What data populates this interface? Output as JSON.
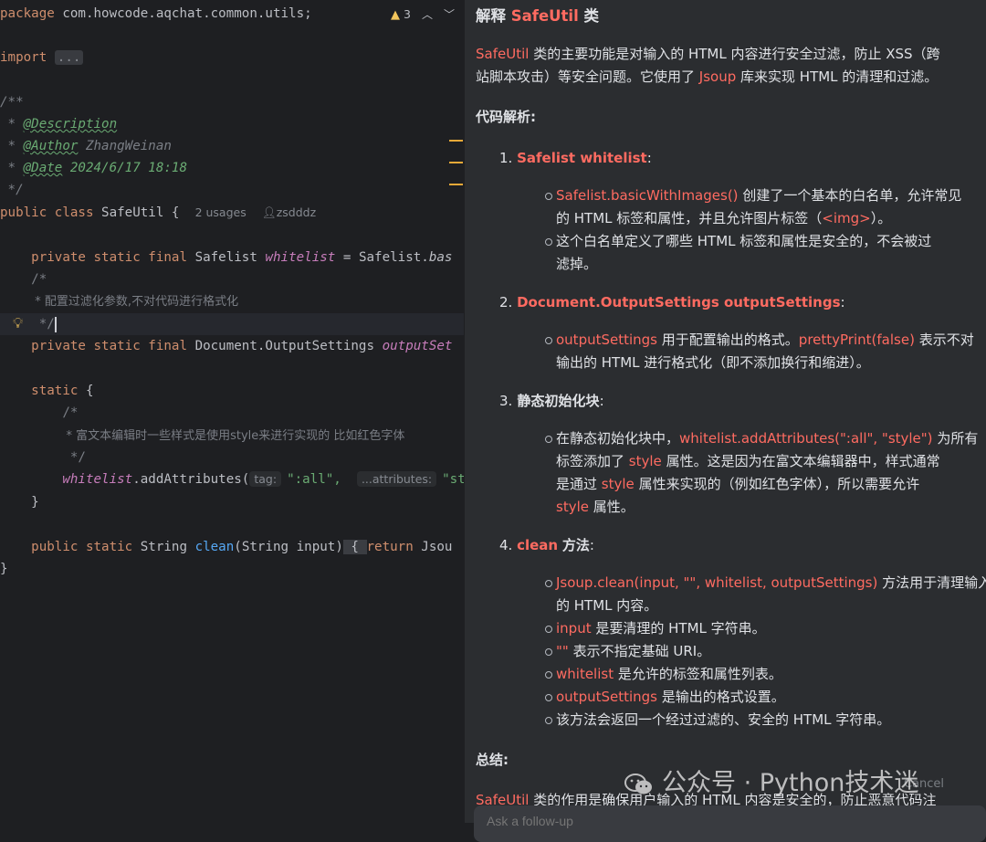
{
  "editor": {
    "warnings": {
      "count": "3"
    },
    "code": {
      "package_kw": "package",
      "package_name": "com.howcode.aqchat.common.utils;",
      "import_kw": "import",
      "import_fold": "...",
      "doc_open": "/**",
      "doc_star": " * ",
      "tag_description": "@Description",
      "tag_author": "@Author",
      "author_value": "ZhangWeinan",
      "tag_date": "@Date",
      "date_value": "2024/6/17 18:18",
      "doc_close": " */",
      "class_kw": "public class",
      "class_name": "SafeUtil {",
      "usages_hint": "2 usages",
      "author_hint": "zsdddz",
      "field1_kw": "private static final",
      "field1_type": "Safelist",
      "field1_name": "whitelist",
      "field1_rest": " = Safelist.",
      "field1_tail": "bas",
      "comment_open": "/*",
      "comment_text": " * 配置过滤化参数,不对代码进行格式化",
      "comment_close": " */",
      "field2_kw": "private static final",
      "field2_type": "Document.OutputSettings",
      "field2_name": "outputSet",
      "static_kw": "static",
      "static_brace": "{",
      "inner_open": "/*",
      "inner_text": " * 富文本编辑时一些样式是使用style来进行实现的 比如红色字体",
      "inner_close": " */",
      "call_obj": "whitelist",
      "call_method": ".addAttributes(",
      "hint_tag": "tag:",
      "arg1": "\":all\",",
      "hint_attrs": "...attributes:",
      "arg2": "\"st",
      "close_brace": "}",
      "method_kw": "public static",
      "method_type": "String",
      "method_name": "clean",
      "method_params": "(String input)",
      "method_brace": "{",
      "method_body_kw": "return",
      "method_body": " Jsou",
      "class_close": "}"
    }
  },
  "panel": {
    "title_prefix": "解释",
    "title_class": "SafeUtil",
    "title_suffix": "类",
    "intro_l1_code": "SafeUtil",
    "intro_l1_text": "类的主要功能是对输入的 HTML 内容进行安全过滤，防止 XSS（跨",
    "intro_l2_text": "站脚本攻击）等安全问题。它使用了",
    "intro_l2_code": "Jsoup",
    "intro_l2_tail": "库来实现 HTML 的清理和过滤。",
    "analysis_heading": "代码解析:",
    "sections": [
      {
        "num": "1.",
        "title": "Safelist whitelist",
        "colon": ":",
        "bullets": [
          {
            "code": "Safelist.basicWithImages()",
            "l1": "创建了一个基本的白名单，允许常见",
            "l2a": "的 HTML 标签和属性，并且允许图片标签（",
            "l2code": "<img>",
            "l2b": "）。"
          },
          {
            "l1": "这个白名单定义了哪些 HTML 标签和属性是安全的，不会被过",
            "l2": "滤掉。"
          }
        ]
      },
      {
        "num": "2.",
        "title": "Document.OutputSettings outputSettings",
        "colon": ":",
        "bullets": [
          {
            "code": "outputSettings",
            "l1a": "用于配置输出的格式。",
            "l1code": "prettyPrint(false)",
            "l1b": "表示不对",
            "l2": "输出的 HTML 进行格式化（即不添加换行和缩进）。"
          }
        ]
      },
      {
        "num": "3.",
        "title": "静态初始化块",
        "colon": ":",
        "bullets": [
          {
            "l1a": "在静态初始化块中，",
            "l1code": "whitelist.addAttributes(\":all\", \"style\")",
            "l1b": "为所有",
            "l2a": "标签添加了",
            "l2code": "style",
            "l2b": "属性。这是因为在富文本编辑器中，样式通常",
            "l3a": "是通过",
            "l3code": "style",
            "l3b": "属性来实现的（例如红色字体），所以需要允许",
            "l4code": "style",
            "l4b": "属性。"
          }
        ]
      },
      {
        "num": "4.",
        "title": "clean",
        "title_rest": "方法",
        "colon": ":",
        "bullets": [
          {
            "code": "Jsoup.clean(input, \"\", whitelist, outputSettings)",
            "l1": "方法用于清理输入",
            "l2": "的 HTML 内容。"
          },
          {
            "code": "input",
            "text": "是要清理的 HTML 字符串。"
          },
          {
            "code": "\"\"",
            "text": "表示不指定基础 URI。"
          },
          {
            "code": "whitelist",
            "text": "是允许的标签和属性列表。"
          },
          {
            "code": "outputSettings",
            "text": "是输出的格式设置。"
          },
          {
            "text": "该方法会返回一个经过过滤的、安全的 HTML 字符串。"
          }
        ]
      }
    ],
    "summary_heading": "总结:",
    "summary_code": "SafeUtil",
    "summary_text": "类的作用是确保用户输入的 HTML 内容是安全的，防止恶意代码注",
    "cancel_label": "Cancel",
    "followup_placeholder": "Ask a follow-up"
  },
  "watermark": {
    "text": "公众号 · Python技术迷"
  },
  "colors": {
    "editor_bg": "#1e1f22",
    "panel_bg": "#2b2d30",
    "keyword": "#cf8e6d",
    "field": "#c77dbb",
    "function": "#56a8f5",
    "string": "#6aab73",
    "inline_code": "#ff6b61"
  }
}
